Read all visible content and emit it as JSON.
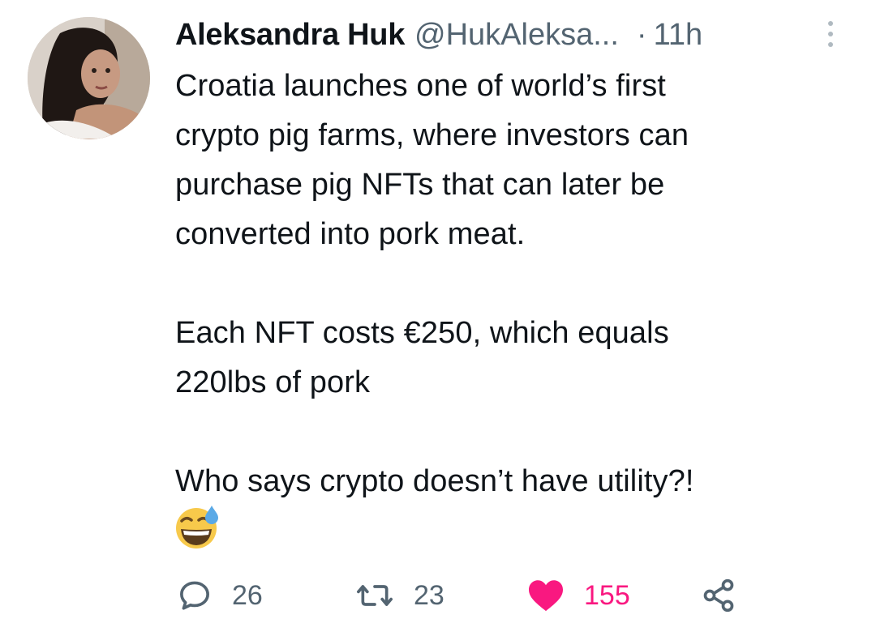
{
  "tweet": {
    "author_name": "Aleksandra Huk",
    "author_handle": "@HukAleksa...",
    "separator": "·",
    "time": "11h",
    "text_lines": {
      "p1": [
        "Croatia launches one of world’s first",
        "crypto pig farms, where investors can",
        "purchase pig NFTs that can later be",
        "converted into pork meat."
      ],
      "p2": [
        "Each NFT costs €250, which equals",
        "220lbs of pork"
      ],
      "p3": [
        "Who says crypto doesn’t have utility?!"
      ]
    },
    "emoji": "grinning-face-with-sweat-icon"
  },
  "actions": {
    "reply_count": "26",
    "retweet_count": "23",
    "like_count": "155",
    "liked": true
  },
  "colors": {
    "text": "#0f1419",
    "secondary": "#536471",
    "like": "#f91880"
  }
}
